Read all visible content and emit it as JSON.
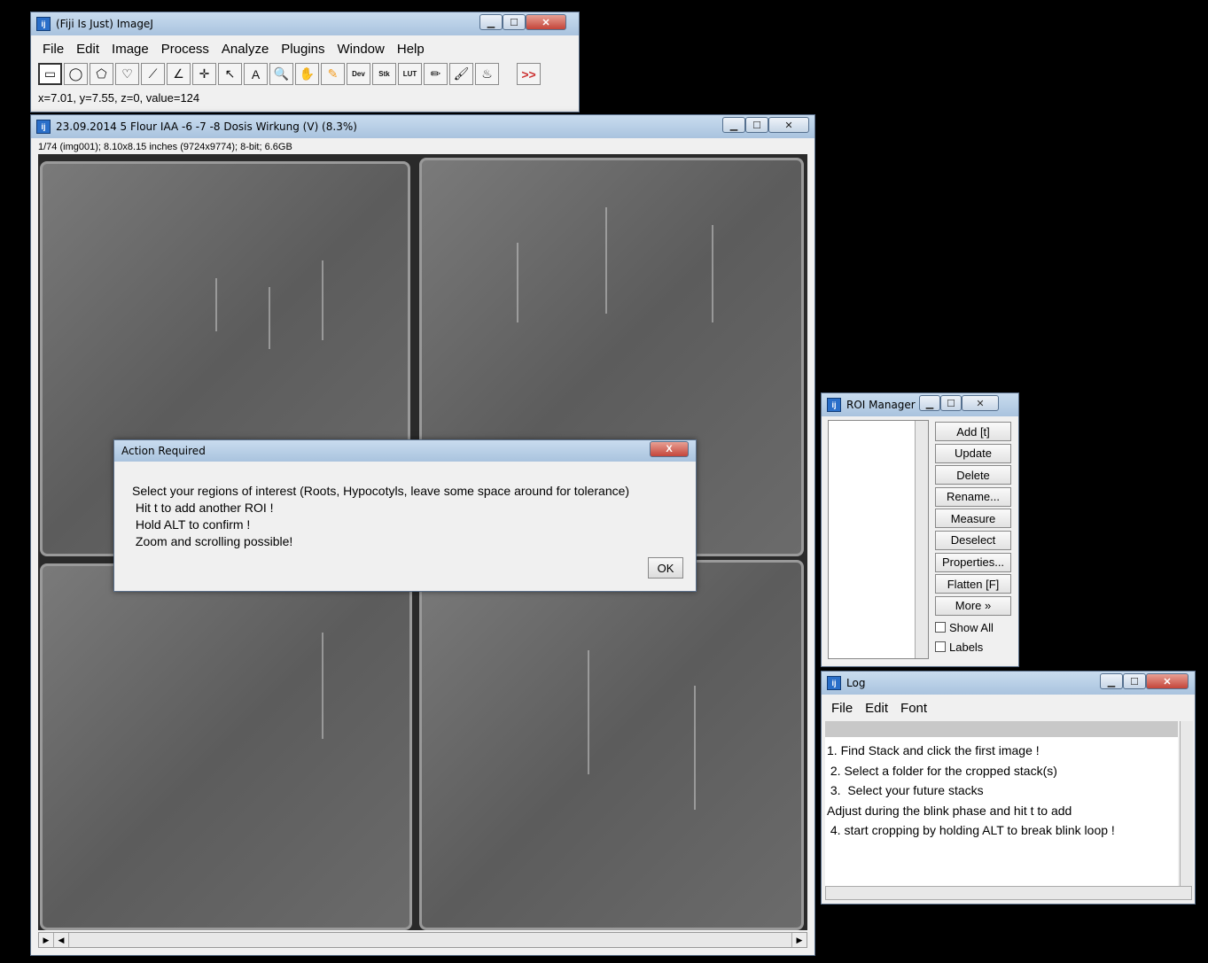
{
  "imagej": {
    "title": "(Fiji Is Just) ImageJ",
    "menu": [
      "File",
      "Edit",
      "Image",
      "Process",
      "Analyze",
      "Plugins",
      "Window",
      "Help"
    ],
    "tools": [
      {
        "name": "rectangle-tool",
        "glyph": "▭"
      },
      {
        "name": "oval-tool",
        "glyph": "◯"
      },
      {
        "name": "polygon-tool",
        "glyph": "⬠"
      },
      {
        "name": "freehand-tool",
        "glyph": "♡"
      },
      {
        "name": "line-tool",
        "glyph": "⟋"
      },
      {
        "name": "angle-tool",
        "glyph": "∠"
      },
      {
        "name": "point-tool",
        "glyph": "✛"
      },
      {
        "name": "wand-tool",
        "glyph": "↖"
      },
      {
        "name": "text-tool",
        "glyph": "A"
      },
      {
        "name": "zoom-tool",
        "glyph": "🔍"
      },
      {
        "name": "hand-tool",
        "glyph": "✋"
      },
      {
        "name": "color-picker-tool",
        "glyph": "✎"
      },
      {
        "name": "dev-menu",
        "glyph": "Dev"
      },
      {
        "name": "stk-menu",
        "glyph": "Stk"
      },
      {
        "name": "lut-menu",
        "glyph": "LUT"
      },
      {
        "name": "pencil-tool",
        "glyph": "✏"
      },
      {
        "name": "brush-tool",
        "glyph": "🖌"
      },
      {
        "name": "flood-fill-tool",
        "glyph": "♨"
      }
    ],
    "more_tools": ">>",
    "status": "x=7.01, y=7.55, z=0, value=124"
  },
  "image_window": {
    "title": "23.09.2014 5 Flour IAA -6 -7 -8 Dosis Wirkung (V) (8.3%)",
    "subtitle": "1/74 (img001); 8.10x8.15 inches (9724x9774); 8-bit; 6.6GB"
  },
  "dialog": {
    "title": "Action Required",
    "lines": [
      "Select your regions of interest (Roots, Hypocotyls, leave some space around for tolerance)",
      " Hit t to add another ROI !",
      " Hold ALT to confirm !",
      " Zoom and scrolling possible!"
    ],
    "ok": "OK",
    "close": "X"
  },
  "roi_manager": {
    "title": "ROI Manager",
    "buttons": [
      "Add [t]",
      "Update",
      "Delete",
      "Rename...",
      "Measure",
      "Deselect",
      "Properties...",
      "Flatten [F]",
      "More »"
    ],
    "show_all": "Show All",
    "labels": "Labels"
  },
  "log": {
    "title": "Log",
    "menu": [
      "File",
      "Edit",
      "Font"
    ],
    "lines": [
      "1. Find Stack and click the first image !",
      " 2. Select a folder for the cropped stack(s)",
      " 3.  Select your future stacks",
      "Adjust during the blink phase and hit t to add",
      " 4. start cropping by holding ALT to break blink loop !"
    ]
  }
}
